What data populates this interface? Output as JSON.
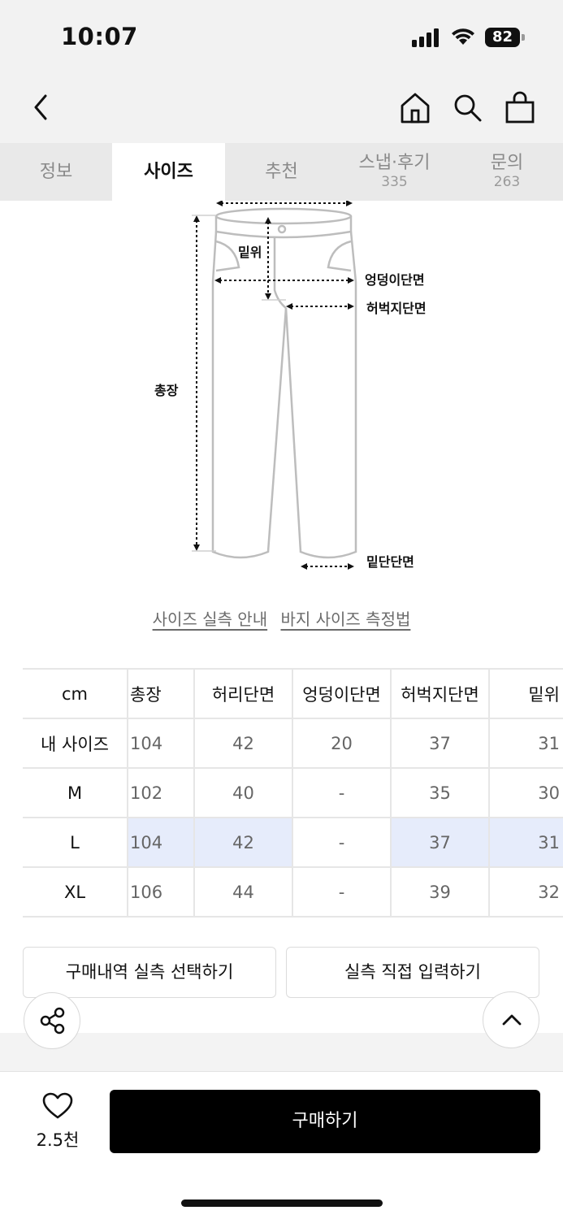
{
  "status_bar": {
    "time": "10:07",
    "battery": "82"
  },
  "nav": {
    "back": "back-icon",
    "home": "home-icon",
    "search": "search-icon",
    "bag": "shopping-bag-icon"
  },
  "tabs": [
    {
      "label": "정보"
    },
    {
      "label": "사이즈",
      "active": true
    },
    {
      "label": "추천"
    },
    {
      "label": "스냅·후기",
      "count": "335"
    },
    {
      "label": "문의",
      "count": "263"
    }
  ],
  "diagram": {
    "labels": {
      "rise": "밑위",
      "hip": "엉덩이단면",
      "thigh": "허벅지단면",
      "length": "총장",
      "hem": "밑단단면"
    }
  },
  "links": {
    "guide": "사이즈 실측 안내",
    "method": "바지 사이즈 측정법"
  },
  "size_table": {
    "headers": [
      "cm",
      "총장",
      "허리단면",
      "엉덩이단면",
      "허벅지단면",
      "밑위"
    ],
    "rows": [
      {
        "label": "내 사이즈",
        "values": [
          "104",
          "42",
          "20",
          "37",
          "31"
        ]
      },
      {
        "label": "M",
        "values": [
          "102",
          "40",
          "-",
          "35",
          "30"
        ]
      },
      {
        "label": "L",
        "values": [
          "104",
          "42",
          "-",
          "37",
          "31"
        ]
      },
      {
        "label": "XL",
        "values": [
          "106",
          "44",
          "-",
          "39",
          "32"
        ]
      }
    ],
    "highlight_color": "#e6ecfb"
  },
  "buttons": {
    "purchase_history": "구매내역 실측 선택하기",
    "direct_input": "실측 직접 입력하기",
    "buy": "구매하기"
  },
  "like": {
    "count": "2.5천"
  }
}
